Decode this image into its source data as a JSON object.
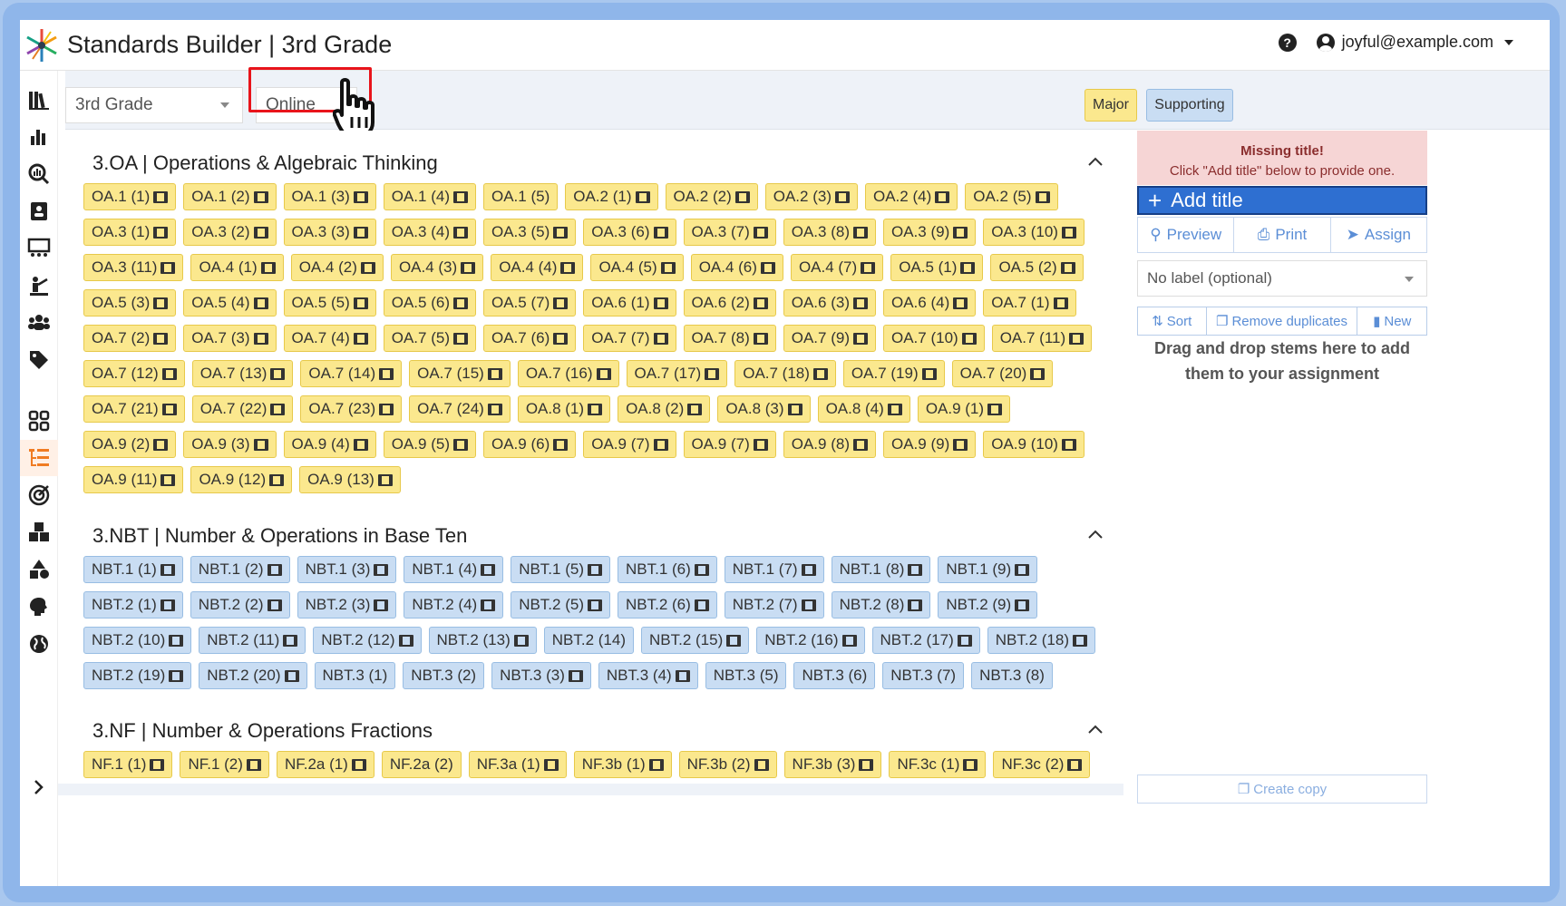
{
  "header": {
    "title": "Standards Builder | 3rd Grade",
    "help_icon": "?",
    "user_email": "joyful@example.com"
  },
  "toolbar": {
    "grade_select": "3rd Grade",
    "mode_select": "Online",
    "legend": {
      "major": "Major",
      "supporting": "Supporting"
    }
  },
  "colors": {
    "major": "#fbe88e",
    "supporting": "#c9ddf3",
    "accent": "#2e6fd1",
    "highlight": "#e8141b"
  },
  "sidebar": {
    "items": [
      "library-icon",
      "chart-icon",
      "search-chart-icon",
      "contacts-icon",
      "classroom-icon",
      "teacher-icon",
      "users-icon",
      "tag-icon",
      "grid-icon",
      "tree-list-icon",
      "target-icon",
      "cubes-icon",
      "shapes-icon",
      "brain-icon",
      "globe-icon",
      "chevron-right-icon"
    ]
  },
  "sections": [
    {
      "title": "3.OA | Operations & Algebraic Thinking",
      "chips": [
        [
          "OA.1 (1)",
          "major",
          1
        ],
        [
          "OA.1 (2)",
          "major",
          1
        ],
        [
          "OA.1 (3)",
          "major",
          1
        ],
        [
          "OA.1 (4)",
          "major",
          1
        ],
        [
          "OA.1 (5)",
          "major",
          0
        ],
        [
          "OA.2 (1)",
          "major",
          1
        ],
        [
          "OA.2 (2)",
          "major",
          1
        ],
        [
          "OA.2 (3)",
          "major",
          1
        ],
        [
          "OA.2 (4)",
          "major",
          1
        ],
        [
          "OA.2 (5)",
          "major",
          1
        ],
        [
          "OA.3 (1)",
          "major",
          1
        ],
        [
          "OA.3 (2)",
          "major",
          1
        ],
        [
          "OA.3 (3)",
          "major",
          1
        ],
        [
          "OA.3 (4)",
          "major",
          1
        ],
        [
          "OA.3 (5)",
          "major",
          1
        ],
        [
          "OA.3 (6)",
          "major",
          1
        ],
        [
          "OA.3 (7)",
          "major",
          1
        ],
        [
          "OA.3 (8)",
          "major",
          1
        ],
        [
          "OA.3 (9)",
          "major",
          1
        ],
        [
          "OA.3 (10)",
          "major",
          1
        ],
        [
          "OA.3 (11)",
          "major",
          1
        ],
        [
          "OA.4 (1)",
          "major",
          1
        ],
        [
          "OA.4 (2)",
          "major",
          1
        ],
        [
          "OA.4 (3)",
          "major",
          1
        ],
        [
          "OA.4 (4)",
          "major",
          1
        ],
        [
          "OA.4 (5)",
          "major",
          1
        ],
        [
          "OA.4 (6)",
          "major",
          1
        ],
        [
          "OA.4 (7)",
          "major",
          1
        ],
        [
          "OA.5 (1)",
          "major",
          1
        ],
        [
          "OA.5 (2)",
          "major",
          1
        ],
        [
          "OA.5 (3)",
          "major",
          1
        ],
        [
          "OA.5 (4)",
          "major",
          1
        ],
        [
          "OA.5 (5)",
          "major",
          1
        ],
        [
          "OA.5 (6)",
          "major",
          1
        ],
        [
          "OA.5 (7)",
          "major",
          1
        ],
        [
          "OA.6 (1)",
          "major",
          1
        ],
        [
          "OA.6 (2)",
          "major",
          1
        ],
        [
          "OA.6 (3)",
          "major",
          1
        ],
        [
          "OA.6 (4)",
          "major",
          1
        ],
        [
          "OA.7 (1)",
          "major",
          1
        ],
        [
          "OA.7 (2)",
          "major",
          1
        ],
        [
          "OA.7 (3)",
          "major",
          1
        ],
        [
          "OA.7 (4)",
          "major",
          1
        ],
        [
          "OA.7 (5)",
          "major",
          1
        ],
        [
          "OA.7 (6)",
          "major",
          1
        ],
        [
          "OA.7 (7)",
          "major",
          1
        ],
        [
          "OA.7 (8)",
          "major",
          1
        ],
        [
          "OA.7 (9)",
          "major",
          1
        ],
        [
          "OA.7 (10)",
          "major",
          1
        ],
        [
          "OA.7 (11)",
          "major",
          1
        ],
        [
          "OA.7 (12)",
          "major",
          1
        ],
        [
          "OA.7 (13)",
          "major",
          1
        ],
        [
          "OA.7 (14)",
          "major",
          1
        ],
        [
          "OA.7 (15)",
          "major",
          1
        ],
        [
          "OA.7 (16)",
          "major",
          1
        ],
        [
          "OA.7 (17)",
          "major",
          1
        ],
        [
          "OA.7 (18)",
          "major",
          1
        ],
        [
          "OA.7 (19)",
          "major",
          1
        ],
        [
          "OA.7 (20)",
          "major",
          1
        ],
        [
          "OA.7 (21)",
          "major",
          1
        ],
        [
          "OA.7 (22)",
          "major",
          1
        ],
        [
          "OA.7 (23)",
          "major",
          1
        ],
        [
          "OA.7 (24)",
          "major",
          1
        ],
        [
          "OA.8 (1)",
          "major",
          1
        ],
        [
          "OA.8 (2)",
          "major",
          1
        ],
        [
          "OA.8 (3)",
          "major",
          1
        ],
        [
          "OA.8 (4)",
          "major",
          1
        ],
        [
          "OA.9 (1)",
          "major",
          1
        ],
        [
          "OA.9 (2)",
          "major",
          1
        ],
        [
          "OA.9 (3)",
          "major",
          1
        ],
        [
          "OA.9 (4)",
          "major",
          1
        ],
        [
          "OA.9 (5)",
          "major",
          1
        ],
        [
          "OA.9 (6)",
          "major",
          1
        ],
        [
          "OA.9 (7)",
          "major",
          1
        ],
        [
          "OA.9 (7)",
          "major",
          1
        ],
        [
          "OA.9 (8)",
          "major",
          1
        ],
        [
          "OA.9 (9)",
          "major",
          1
        ],
        [
          "OA.9 (10)",
          "major",
          1
        ],
        [
          "OA.9 (11)",
          "major",
          1
        ],
        [
          "OA.9 (12)",
          "major",
          1
        ],
        [
          "OA.9 (13)",
          "major",
          1
        ]
      ]
    },
    {
      "title": "3.NBT | Number & Operations in Base Ten",
      "chips": [
        [
          "NBT.1 (1)",
          "supporting",
          1
        ],
        [
          "NBT.1 (2)",
          "supporting",
          1
        ],
        [
          "NBT.1 (3)",
          "supporting",
          1
        ],
        [
          "NBT.1 (4)",
          "supporting",
          1
        ],
        [
          "NBT.1 (5)",
          "supporting",
          1
        ],
        [
          "NBT.1 (6)",
          "supporting",
          1
        ],
        [
          "NBT.1 (7)",
          "supporting",
          1
        ],
        [
          "NBT.1 (8)",
          "supporting",
          1
        ],
        [
          "NBT.1 (9)",
          "supporting",
          1
        ],
        [
          "NBT.2 (1)",
          "supporting",
          1
        ],
        [
          "NBT.2 (2)",
          "supporting",
          1
        ],
        [
          "NBT.2 (3)",
          "supporting",
          1
        ],
        [
          "NBT.2 (4)",
          "supporting",
          1
        ],
        [
          "NBT.2 (5)",
          "supporting",
          1
        ],
        [
          "NBT.2 (6)",
          "supporting",
          1
        ],
        [
          "NBT.2 (7)",
          "supporting",
          1
        ],
        [
          "NBT.2 (8)",
          "supporting",
          1
        ],
        [
          "NBT.2 (9)",
          "supporting",
          1
        ],
        [
          "NBT.2 (10)",
          "supporting",
          1
        ],
        [
          "NBT.2 (11)",
          "supporting",
          1
        ],
        [
          "NBT.2 (12)",
          "supporting",
          1
        ],
        [
          "NBT.2 (13)",
          "supporting",
          1
        ],
        [
          "NBT.2 (14)",
          "supporting",
          0
        ],
        [
          "NBT.2 (15)",
          "supporting",
          1
        ],
        [
          "NBT.2 (16)",
          "supporting",
          1
        ],
        [
          "NBT.2 (17)",
          "supporting",
          1
        ],
        [
          "NBT.2 (18)",
          "supporting",
          1
        ],
        [
          "NBT.2 (19)",
          "supporting",
          1
        ],
        [
          "NBT.2 (20)",
          "supporting",
          1
        ],
        [
          "NBT.3 (1)",
          "supporting",
          0
        ],
        [
          "NBT.3 (2)",
          "supporting",
          0
        ],
        [
          "NBT.3 (3)",
          "supporting",
          1
        ],
        [
          "NBT.3 (4)",
          "supporting",
          1
        ],
        [
          "NBT.3 (5)",
          "supporting",
          0
        ],
        [
          "NBT.3 (6)",
          "supporting",
          0
        ],
        [
          "NBT.3 (7)",
          "supporting",
          0
        ],
        [
          "NBT.3 (8)",
          "supporting",
          0
        ]
      ]
    },
    {
      "title": "3.NF | Number & Operations Fractions",
      "chips": [
        [
          "NF.1 (1)",
          "major",
          1
        ],
        [
          "NF.1 (2)",
          "major",
          1
        ],
        [
          "NF.2a (1)",
          "major",
          1
        ],
        [
          "NF.2a (2)",
          "major",
          0
        ],
        [
          "NF.3a (1)",
          "major",
          1
        ],
        [
          "NF.3b (1)",
          "major",
          1
        ],
        [
          "NF.3b (2)",
          "major",
          1
        ],
        [
          "NF.3b (3)",
          "major",
          1
        ],
        [
          "NF.3c (1)",
          "major",
          1
        ],
        [
          "NF.3c (2)",
          "major",
          1
        ]
      ]
    }
  ],
  "panel": {
    "missing_title": "Missing title!",
    "missing_hint": "Click \"Add title\" below to provide one.",
    "add_title": "Add title",
    "preview": "Preview",
    "print": "Print",
    "assign": "Assign",
    "label_placeholder": "No label (optional)",
    "sort": "Sort",
    "remove_duplicates": "Remove duplicates",
    "new": "New",
    "drag_hint": "Drag and drop stems here to add them to your assignment",
    "create_copy": "Create copy"
  }
}
